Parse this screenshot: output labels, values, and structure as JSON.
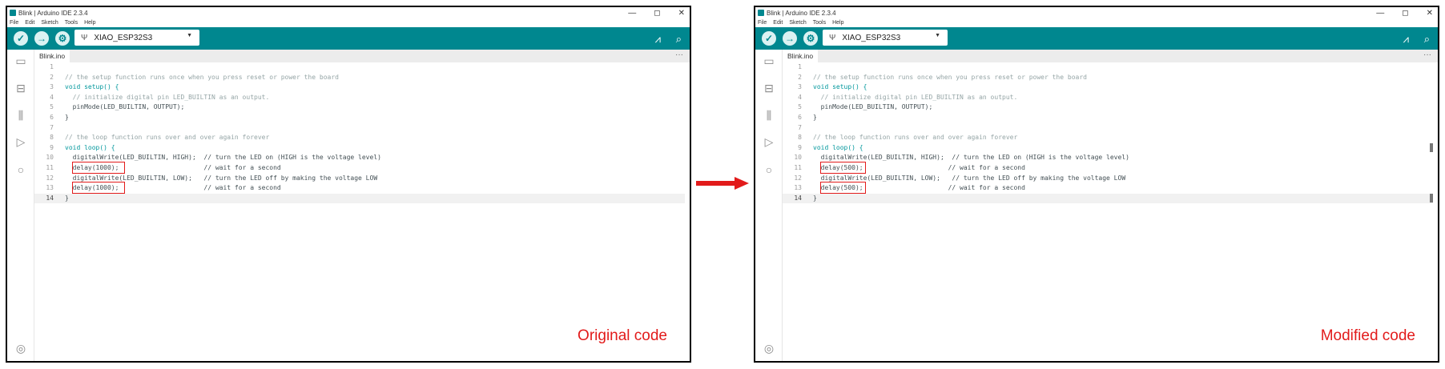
{
  "panels": [
    {
      "title": "Blink | Arduino IDE 2.3.4",
      "window_controls": [
        "—",
        "◻",
        "✕"
      ],
      "menu": [
        "File",
        "Edit",
        "Sketch",
        "Tools",
        "Help"
      ],
      "board": "XIAO_ESP32S3",
      "tab": "Blink.ino",
      "caption": "Original code",
      "lines": [
        {
          "n": "1",
          "code": ""
        },
        {
          "n": "2",
          "code": "// the setup function runs once when you press reset or power the board"
        },
        {
          "n": "3",
          "code": "void setup() {"
        },
        {
          "n": "4",
          "code": "  // initialize digital pin LED_BUILTIN as an output."
        },
        {
          "n": "5",
          "code": "  pinMode(LED_BUILTIN, OUTPUT);"
        },
        {
          "n": "6",
          "code": "}"
        },
        {
          "n": "7",
          "code": ""
        },
        {
          "n": "8",
          "code": "// the loop function runs over and over again forever"
        },
        {
          "n": "9",
          "code": "void loop() {"
        },
        {
          "n": "10",
          "code": "  digitalWrite(LED_BUILTIN, HIGH);  // turn the LED on (HIGH is the voltage level)"
        },
        {
          "n": "11",
          "code": "  delay(1000);                      // wait for a second"
        },
        {
          "n": "12",
          "code": "  digitalWrite(LED_BUILTIN, LOW);   // turn the LED off by making the voltage LOW"
        },
        {
          "n": "13",
          "code": "  delay(1000);                      // wait for a second"
        },
        {
          "n": "14",
          "code": "}"
        }
      ]
    },
    {
      "title": "Blink | Arduino IDE 2.3.4",
      "window_controls": [
        "—",
        "◻",
        "✕"
      ],
      "menu": [
        "File",
        "Edit",
        "Sketch",
        "Tools",
        "Help"
      ],
      "board": "XIAO_ESP32S3",
      "tab": "Blink.ino",
      "caption": "Modified code",
      "lines": [
        {
          "n": "1",
          "code": ""
        },
        {
          "n": "2",
          "code": "// the setup function runs once when you press reset or power the board"
        },
        {
          "n": "3",
          "code": "void setup() {"
        },
        {
          "n": "4",
          "code": "  // initialize digital pin LED_BUILTIN as an output."
        },
        {
          "n": "5",
          "code": "  pinMode(LED_BUILTIN, OUTPUT);"
        },
        {
          "n": "6",
          "code": "}"
        },
        {
          "n": "7",
          "code": ""
        },
        {
          "n": "8",
          "code": "// the loop function runs over and over again forever"
        },
        {
          "n": "9",
          "code": "void loop() {"
        },
        {
          "n": "10",
          "code": "  digitalWrite(LED_BUILTIN, HIGH);  // turn the LED on (HIGH is the voltage level)"
        },
        {
          "n": "11",
          "code": "  delay(500);                      // wait for a second"
        },
        {
          "n": "12",
          "code": "  digitalWrite(LED_BUILTIN, LOW);   // turn the LED off by making the voltage LOW"
        },
        {
          "n": "13",
          "code": "  delay(500);                      // wait for a second"
        },
        {
          "n": "14",
          "code": "}"
        }
      ]
    }
  ],
  "colors": {
    "toolbar": "#00878f",
    "highlight": "#e21b1b",
    "arrow": "#e21b1b",
    "keyword": "#00979c",
    "function": "#d35400",
    "comment": "#95a5a6"
  },
  "icons": {
    "verify": "check-icon",
    "upload": "arrow-right-icon",
    "debug": "debug-icon",
    "usb": "usb-icon",
    "serial_plotter": "plotter-icon",
    "serial_monitor": "magnifier-icon",
    "sidebar": [
      "folder-icon",
      "board-icon",
      "library-icon",
      "debug-icon",
      "search-icon",
      "account-icon"
    ]
  }
}
